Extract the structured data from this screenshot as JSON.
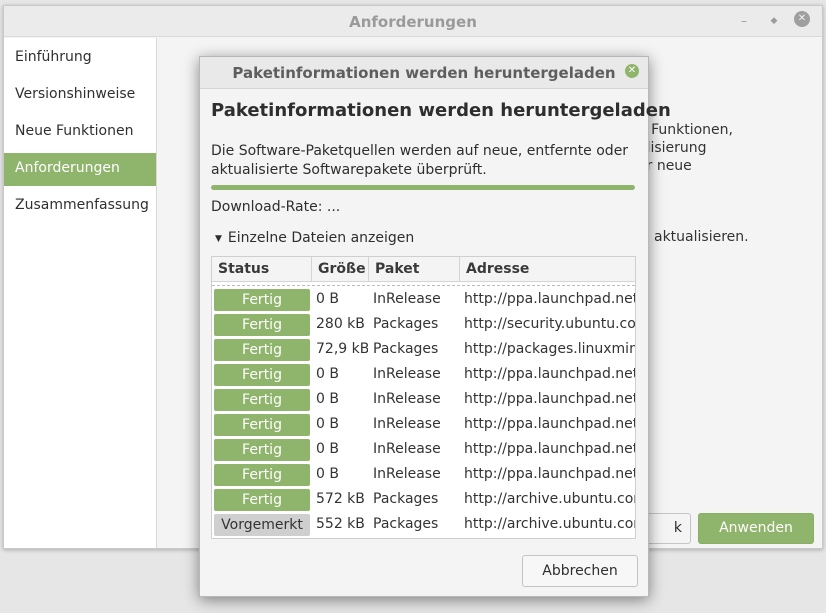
{
  "main_window": {
    "title": "Anforderungen",
    "sidebar": {
      "items": [
        {
          "label": "Einführung"
        },
        {
          "label": "Versionshinweise"
        },
        {
          "label": "Neue Funktionen"
        },
        {
          "label": "Anforderungen"
        },
        {
          "label": "Zusammenfassung"
        }
      ]
    },
    "content": {
      "partial_line1": "e Funktionen,",
      "partial_line2": "alisierung",
      "partial_line3": "er neue",
      "partial_line4": "aktualisieren."
    },
    "back_button_label": "k",
    "apply_button_label": "Anwenden"
  },
  "dialog": {
    "title": "Paketinformationen werden heruntergeladen",
    "heading": "Paketinformationen werden heruntergeladen",
    "description": "Die Software-Paketquellen werden auf neue, entfernte oder aktualisierte Softwarepakete überprüft.",
    "progress": 1.0,
    "download_rate": "Download-Rate: ...",
    "expander_label": "Einzelne Dateien anzeigen",
    "table": {
      "headers": {
        "status": "Status",
        "size": "Größe",
        "package": "Paket",
        "address": "Adresse"
      },
      "rows": [
        {
          "status": "Fertig",
          "size": "0  B",
          "package": "InRelease",
          "address": "http://ppa.launchpad.net/",
          "done": true
        },
        {
          "status": "Fertig",
          "size": "280 kB",
          "package": "Packages",
          "address": "http://security.ubuntu.com",
          "done": true
        },
        {
          "status": "Fertig",
          "size": "72,9 kB",
          "package": "Packages",
          "address": "http://packages.linuxmint",
          "done": true
        },
        {
          "status": "Fertig",
          "size": "0  B",
          "package": "InRelease",
          "address": "http://ppa.launchpad.net/",
          "done": true
        },
        {
          "status": "Fertig",
          "size": "0  B",
          "package": "InRelease",
          "address": "http://ppa.launchpad.net/",
          "done": true
        },
        {
          "status": "Fertig",
          "size": "0  B",
          "package": "InRelease",
          "address": "http://ppa.launchpad.net/",
          "done": true
        },
        {
          "status": "Fertig",
          "size": "0  B",
          "package": "InRelease",
          "address": "http://ppa.launchpad.net/",
          "done": true
        },
        {
          "status": "Fertig",
          "size": "0  B",
          "package": "InRelease",
          "address": "http://ppa.launchpad.net/",
          "done": true
        },
        {
          "status": "Fertig",
          "size": "572 kB",
          "package": "Packages",
          "address": "http://archive.ubuntu.com",
          "done": true
        },
        {
          "status": "Vorgemerkt",
          "size": "552 kB",
          "package": "Packages",
          "address": "http://archive.ubuntu.com",
          "done": false
        }
      ]
    },
    "cancel_button_label": "Abbrechen"
  },
  "colors": {
    "accent": "#8fb46b",
    "pending": "#cfcfcf"
  },
  "icons": {
    "window_minimize": "minimize-icon",
    "window_maximize": "maximize-icon",
    "window_close": "close-icon",
    "dialog_close": "close-icon",
    "expander": "triangle-down-icon"
  }
}
